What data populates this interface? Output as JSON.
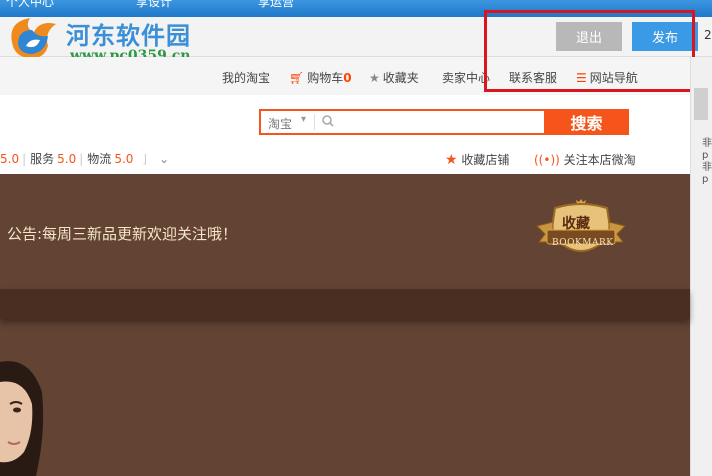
{
  "topbar": {
    "items": [
      "个人中心",
      "享设计",
      "享运营"
    ]
  },
  "watermark": {
    "title": "河东软件园",
    "url": "www.pc0359.cn"
  },
  "editor": {
    "exit_label": "退出",
    "publish_label": "发布",
    "edge_digit": "2"
  },
  "sitenav": {
    "my_taobao": "我的淘宝",
    "cart": "购物车",
    "cart_count": "0",
    "favorites": "收藏夹",
    "seller_center": "卖家中心",
    "customer_service": "联系客服",
    "site_nav": "网站导航"
  },
  "search": {
    "scope": "淘宝",
    "placeholder": "",
    "button": "搜索"
  },
  "ratings": {
    "first_score": "5.0",
    "service_label": "服务",
    "service_score": "5.0",
    "logistics_label": "物流",
    "logistics_score": "5.0"
  },
  "shop_actions": {
    "fav_shop": "收藏店铺",
    "follow_weitao": "关注本店微淘"
  },
  "banner": {
    "notice": "公告:每周三新品更新欢迎关注哦！",
    "badge_cn": "收藏",
    "badge_en": "BOOKMARK"
  },
  "scrollbar": {
    "ticks": [
      "非",
      "p",
      "非",
      "p"
    ]
  },
  "colors": {
    "accent_orange": "#f5541a",
    "topbar_blue": "#2a85d2",
    "banner_brown": "#624334",
    "highlight_red": "#d8161f",
    "publish_blue": "#3b9ae6"
  }
}
